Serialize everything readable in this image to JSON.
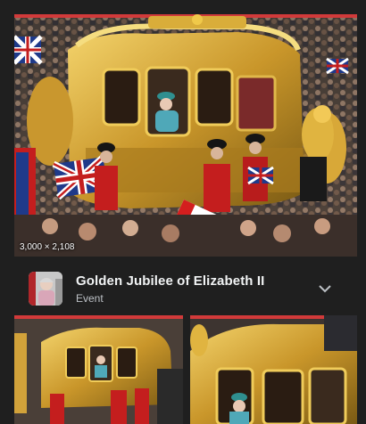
{
  "main_image": {
    "dimensions_label": "3,000 × 2,108",
    "alt": "Golden State Coach at the Golden Jubilee"
  },
  "entity": {
    "title": "Golden Jubilee of Elizabeth II",
    "subtitle": "Event"
  },
  "colors": {
    "background": "#1f1f1f",
    "gold": "#c9a227",
    "guard_red": "#c41e1e",
    "union_blue": "#1f3a8a"
  },
  "icons": {
    "expand": "chevron-down-icon"
  }
}
